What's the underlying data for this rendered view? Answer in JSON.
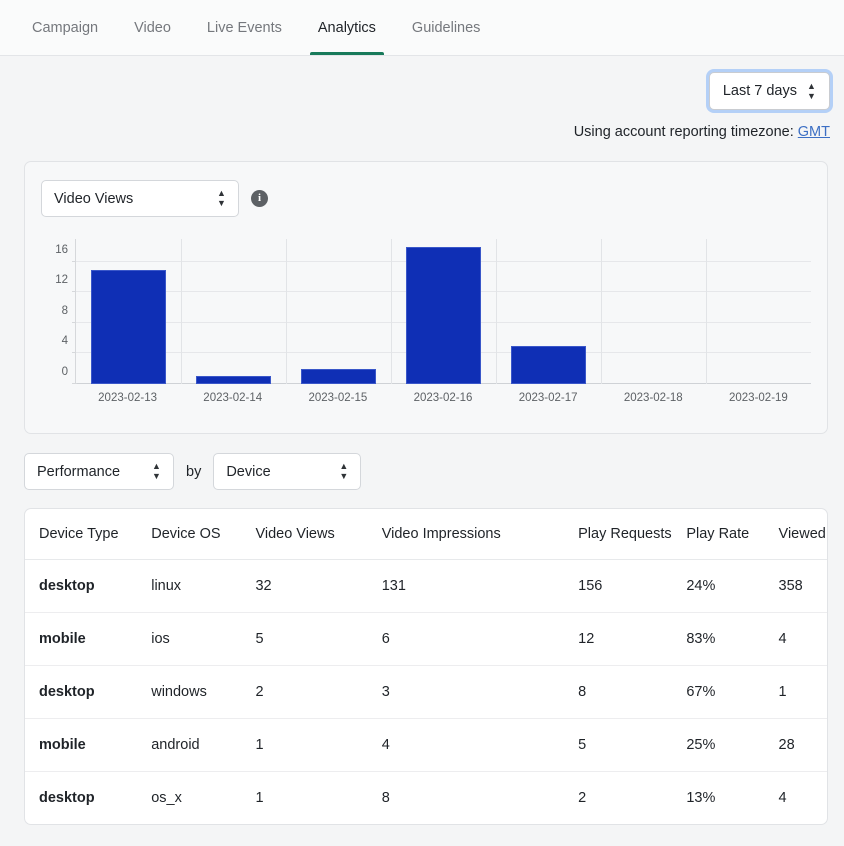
{
  "tabs": [
    {
      "label": "Campaign",
      "active": false
    },
    {
      "label": "Video",
      "active": false
    },
    {
      "label": "Live Events",
      "active": false
    },
    {
      "label": "Analytics",
      "active": true
    },
    {
      "label": "Guidelines",
      "active": false
    }
  ],
  "toolbar": {
    "date_range": "Last 7 days"
  },
  "timezone_note": {
    "text": "Using account reporting timezone:",
    "link": "GMT"
  },
  "chart_panel": {
    "metric_selected": "Video Views",
    "info_icon": "info-icon"
  },
  "breakdown": {
    "metric": "Performance",
    "by_word": "by",
    "dimension": "Device"
  },
  "chart_data": {
    "type": "bar",
    "title": "",
    "xlabel": "",
    "ylabel": "",
    "categories": [
      "2023-02-13",
      "2023-02-14",
      "2023-02-15",
      "2023-02-16",
      "2023-02-17",
      "2023-02-18",
      "2023-02-19"
    ],
    "values": [
      15,
      1,
      2,
      18,
      5,
      0,
      0
    ],
    "yticks": [
      0,
      4,
      8,
      12,
      16
    ],
    "ylim": [
      0,
      19
    ],
    "grid": true,
    "legend": false,
    "bar_color": "#0f2fb5"
  },
  "table": {
    "columns": [
      "Device Type",
      "Device OS",
      "Video Views",
      "Video Impressions",
      "Play Requests",
      "Play Rate",
      "Viewed Minutes"
    ],
    "rows": [
      {
        "device_type": "desktop",
        "device_os": "linux",
        "video_views": "32",
        "video_impressions": "131",
        "play_requests": "156",
        "play_rate": "24%",
        "viewed_minutes": "358"
      },
      {
        "device_type": "mobile",
        "device_os": "ios",
        "video_views": "5",
        "video_impressions": "6",
        "play_requests": "12",
        "play_rate": "83%",
        "viewed_minutes": "4"
      },
      {
        "device_type": "desktop",
        "device_os": "windows",
        "video_views": "2",
        "video_impressions": "3",
        "play_requests": "8",
        "play_rate": "67%",
        "viewed_minutes": "1"
      },
      {
        "device_type": "mobile",
        "device_os": "android",
        "video_views": "1",
        "video_impressions": "4",
        "play_requests": "5",
        "play_rate": "25%",
        "viewed_minutes": "28"
      },
      {
        "device_type": "desktop",
        "device_os": "os_x",
        "video_views": "1",
        "video_impressions": "8",
        "play_requests": "2",
        "play_rate": "13%",
        "viewed_minutes": "4"
      }
    ]
  },
  "colors": {
    "accent_tab": "#187a5a",
    "bar": "#0f2fb5",
    "link": "#3c6fc4",
    "focus_ring": "#b4d0f7"
  }
}
